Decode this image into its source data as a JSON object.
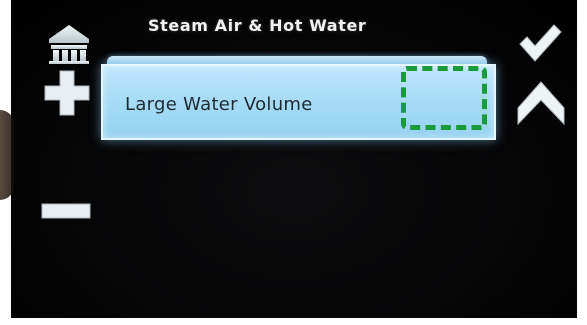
{
  "screen": {
    "title": "Steam Air & Hot Water"
  },
  "setting": {
    "label": "Large Water Volume"
  },
  "icons": {
    "home": "home-icon",
    "plus": "plus-icon",
    "minus": "minus-icon",
    "check": "checkmark-icon",
    "up": "chevron-up-icon"
  },
  "colors": {
    "screen_background": "#000000",
    "field_fill": "#a8dcf7",
    "highlight_outline": "#1a9a3a",
    "icon_color": "#e8f0f4"
  }
}
